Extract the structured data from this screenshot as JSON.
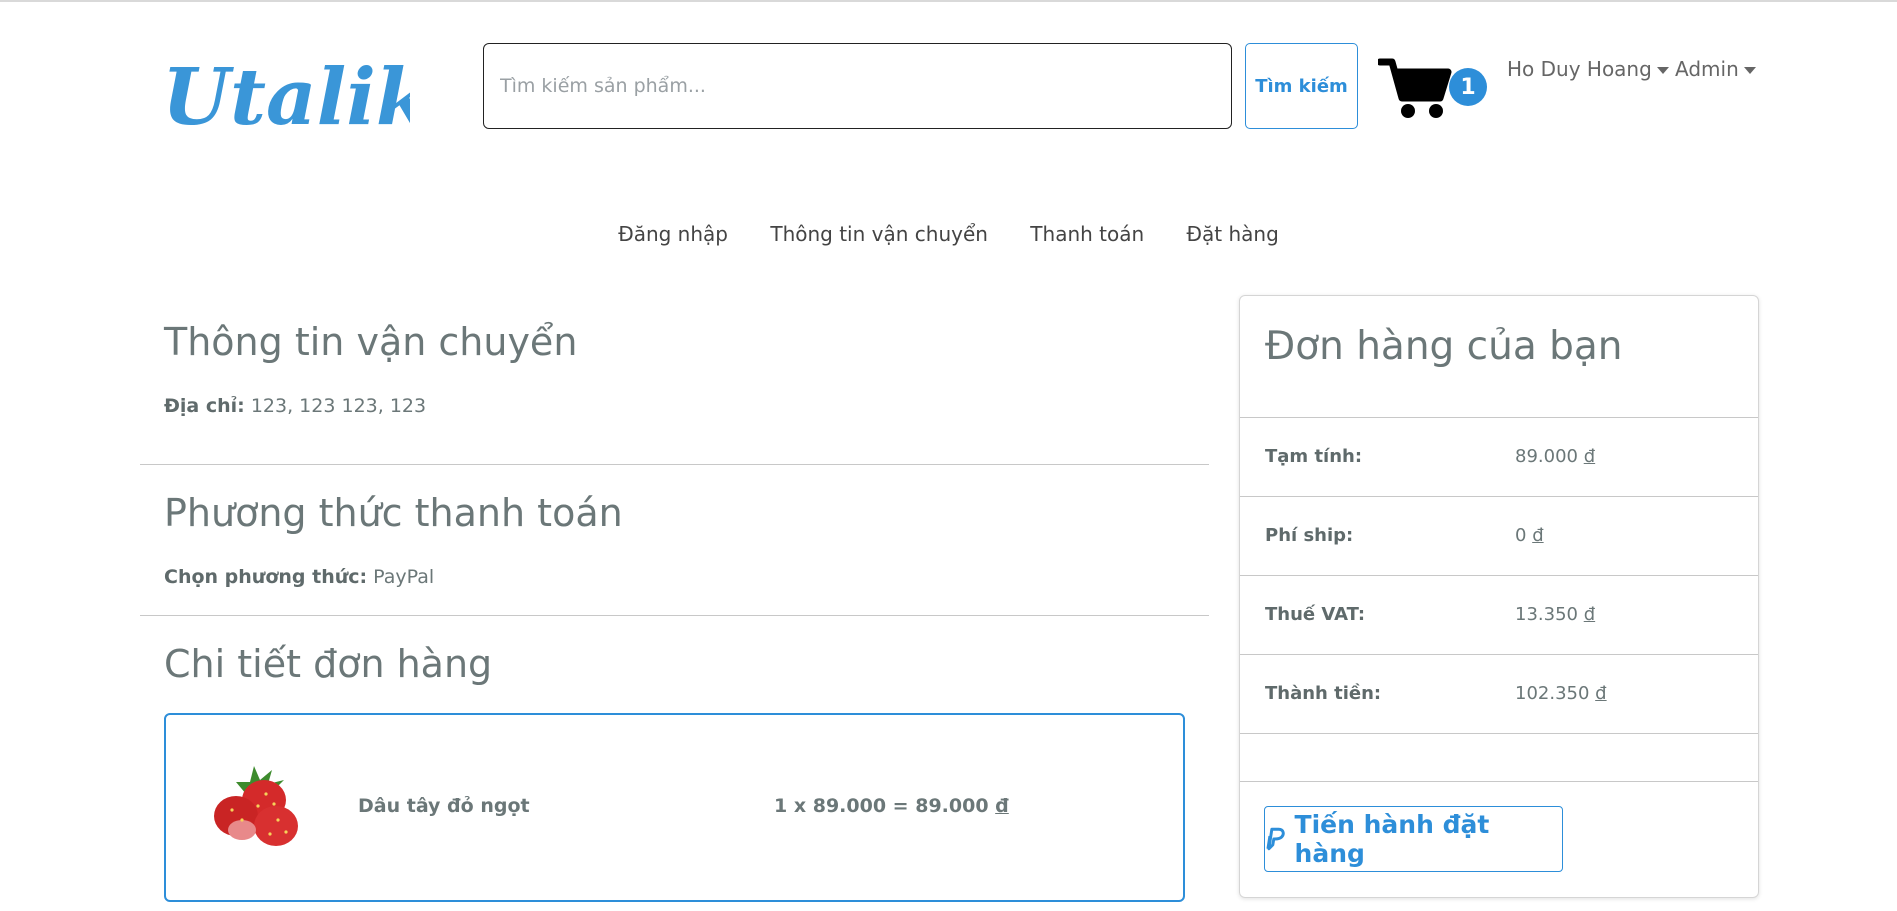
{
  "brand": {
    "logo_text": "Utalik",
    "accent_color": "#2d8ed9"
  },
  "search": {
    "placeholder": "Tìm kiếm sản phẩm...",
    "button_label": "Tìm kiếm"
  },
  "cart": {
    "icon": "cart-icon",
    "count": "1"
  },
  "user_menu": {
    "name": "Ho Duy Hoang",
    "admin_label": "Admin"
  },
  "steps": [
    "Đăng nhập",
    "Thông tin vận chuyển",
    "Thanh toán",
    "Đặt hàng"
  ],
  "shipping": {
    "title": "Thông tin vận chuyển",
    "address_label": "Địa chỉ:",
    "address_value": "123, 123 123, 123"
  },
  "payment": {
    "title": "Phương thức thanh toán",
    "method_label": "Chọn phương thức:",
    "method_value": "PayPal"
  },
  "order_details": {
    "title": "Chi tiết đơn hàng",
    "items": [
      {
        "name": "Dâu tây đỏ ngọt",
        "quantity": "1",
        "unit_price": "89.000",
        "total": "89.000",
        "currency": "đ",
        "image_icon": "strawberry-image"
      }
    ]
  },
  "summary": {
    "title": "Đơn hàng của bạn",
    "rows": [
      {
        "label": "Tạm tính:",
        "amount": "89.000",
        "currency": "đ"
      },
      {
        "label": "Phí ship:",
        "amount": "0",
        "currency": "đ"
      },
      {
        "label": "Thuế VAT:",
        "amount": "13.350",
        "currency": "đ"
      },
      {
        "label": "Thành tiền:",
        "amount": "102.350",
        "currency": "đ"
      }
    ],
    "checkout_button": "Tiến hành đặt hàng",
    "checkout_icon": "paypal-icon"
  }
}
